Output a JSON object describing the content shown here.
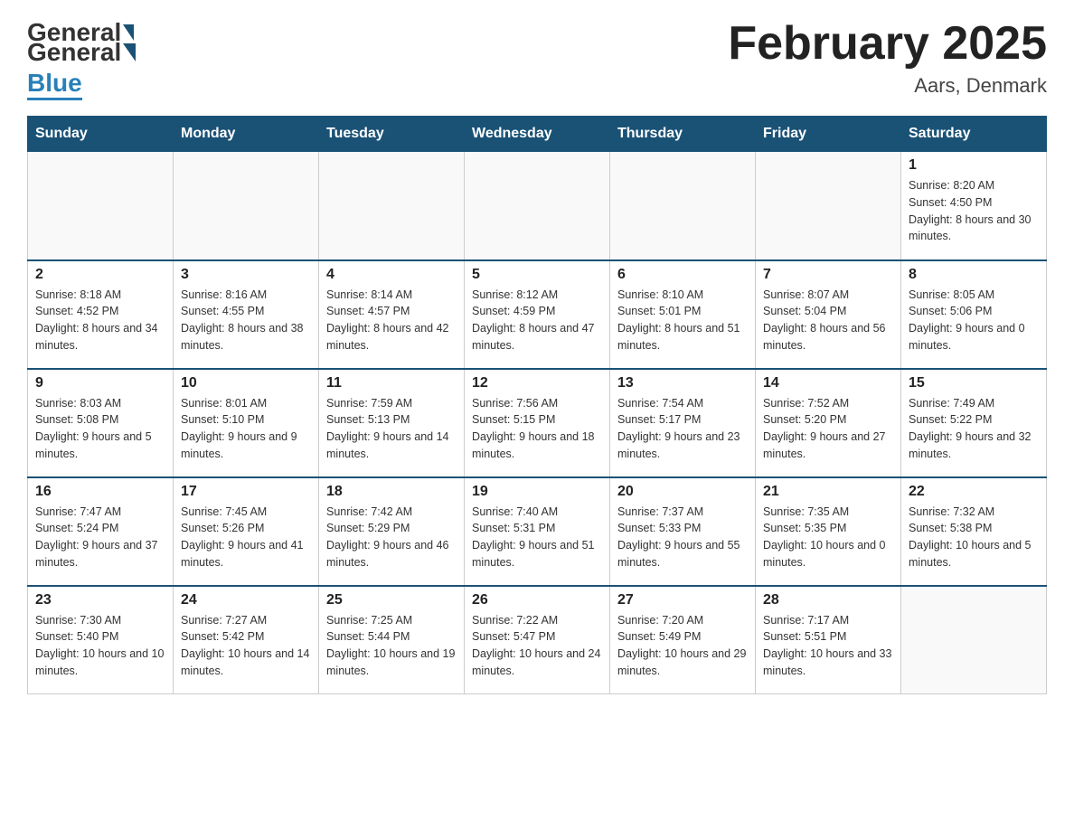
{
  "header": {
    "logo_general": "General",
    "logo_blue": "Blue",
    "month_title": "February 2025",
    "location": "Aars, Denmark"
  },
  "days_of_week": [
    "Sunday",
    "Monday",
    "Tuesday",
    "Wednesday",
    "Thursday",
    "Friday",
    "Saturday"
  ],
  "weeks": [
    [
      {
        "day": "",
        "info": ""
      },
      {
        "day": "",
        "info": ""
      },
      {
        "day": "",
        "info": ""
      },
      {
        "day": "",
        "info": ""
      },
      {
        "day": "",
        "info": ""
      },
      {
        "day": "",
        "info": ""
      },
      {
        "day": "1",
        "info": "Sunrise: 8:20 AM\nSunset: 4:50 PM\nDaylight: 8 hours and 30 minutes."
      }
    ],
    [
      {
        "day": "2",
        "info": "Sunrise: 8:18 AM\nSunset: 4:52 PM\nDaylight: 8 hours and 34 minutes."
      },
      {
        "day": "3",
        "info": "Sunrise: 8:16 AM\nSunset: 4:55 PM\nDaylight: 8 hours and 38 minutes."
      },
      {
        "day": "4",
        "info": "Sunrise: 8:14 AM\nSunset: 4:57 PM\nDaylight: 8 hours and 42 minutes."
      },
      {
        "day": "5",
        "info": "Sunrise: 8:12 AM\nSunset: 4:59 PM\nDaylight: 8 hours and 47 minutes."
      },
      {
        "day": "6",
        "info": "Sunrise: 8:10 AM\nSunset: 5:01 PM\nDaylight: 8 hours and 51 minutes."
      },
      {
        "day": "7",
        "info": "Sunrise: 8:07 AM\nSunset: 5:04 PM\nDaylight: 8 hours and 56 minutes."
      },
      {
        "day": "8",
        "info": "Sunrise: 8:05 AM\nSunset: 5:06 PM\nDaylight: 9 hours and 0 minutes."
      }
    ],
    [
      {
        "day": "9",
        "info": "Sunrise: 8:03 AM\nSunset: 5:08 PM\nDaylight: 9 hours and 5 minutes."
      },
      {
        "day": "10",
        "info": "Sunrise: 8:01 AM\nSunset: 5:10 PM\nDaylight: 9 hours and 9 minutes."
      },
      {
        "day": "11",
        "info": "Sunrise: 7:59 AM\nSunset: 5:13 PM\nDaylight: 9 hours and 14 minutes."
      },
      {
        "day": "12",
        "info": "Sunrise: 7:56 AM\nSunset: 5:15 PM\nDaylight: 9 hours and 18 minutes."
      },
      {
        "day": "13",
        "info": "Sunrise: 7:54 AM\nSunset: 5:17 PM\nDaylight: 9 hours and 23 minutes."
      },
      {
        "day": "14",
        "info": "Sunrise: 7:52 AM\nSunset: 5:20 PM\nDaylight: 9 hours and 27 minutes."
      },
      {
        "day": "15",
        "info": "Sunrise: 7:49 AM\nSunset: 5:22 PM\nDaylight: 9 hours and 32 minutes."
      }
    ],
    [
      {
        "day": "16",
        "info": "Sunrise: 7:47 AM\nSunset: 5:24 PM\nDaylight: 9 hours and 37 minutes."
      },
      {
        "day": "17",
        "info": "Sunrise: 7:45 AM\nSunset: 5:26 PM\nDaylight: 9 hours and 41 minutes."
      },
      {
        "day": "18",
        "info": "Sunrise: 7:42 AM\nSunset: 5:29 PM\nDaylight: 9 hours and 46 minutes."
      },
      {
        "day": "19",
        "info": "Sunrise: 7:40 AM\nSunset: 5:31 PM\nDaylight: 9 hours and 51 minutes."
      },
      {
        "day": "20",
        "info": "Sunrise: 7:37 AM\nSunset: 5:33 PM\nDaylight: 9 hours and 55 minutes."
      },
      {
        "day": "21",
        "info": "Sunrise: 7:35 AM\nSunset: 5:35 PM\nDaylight: 10 hours and 0 minutes."
      },
      {
        "day": "22",
        "info": "Sunrise: 7:32 AM\nSunset: 5:38 PM\nDaylight: 10 hours and 5 minutes."
      }
    ],
    [
      {
        "day": "23",
        "info": "Sunrise: 7:30 AM\nSunset: 5:40 PM\nDaylight: 10 hours and 10 minutes."
      },
      {
        "day": "24",
        "info": "Sunrise: 7:27 AM\nSunset: 5:42 PM\nDaylight: 10 hours and 14 minutes."
      },
      {
        "day": "25",
        "info": "Sunrise: 7:25 AM\nSunset: 5:44 PM\nDaylight: 10 hours and 19 minutes."
      },
      {
        "day": "26",
        "info": "Sunrise: 7:22 AM\nSunset: 5:47 PM\nDaylight: 10 hours and 24 minutes."
      },
      {
        "day": "27",
        "info": "Sunrise: 7:20 AM\nSunset: 5:49 PM\nDaylight: 10 hours and 29 minutes."
      },
      {
        "day": "28",
        "info": "Sunrise: 7:17 AM\nSunset: 5:51 PM\nDaylight: 10 hours and 33 minutes."
      },
      {
        "day": "",
        "info": ""
      }
    ]
  ]
}
